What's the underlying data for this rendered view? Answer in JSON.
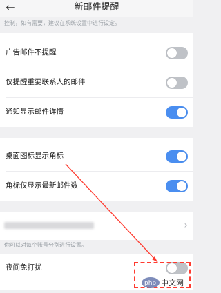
{
  "header": {
    "back_icon": "back-arrow-icon",
    "title": "新邮件提醒"
  },
  "description": "控制，如有需要，建议在系统设置中进行设定。",
  "group1": {
    "rows": [
      {
        "label": "广告邮件不提醒",
        "toggle_on": false
      },
      {
        "label": "仅提醒重要联系人的邮件",
        "toggle_on": false
      },
      {
        "label": "通知显示邮件详情",
        "toggle_on": true
      }
    ]
  },
  "group2": {
    "rows": [
      {
        "label": "桌面图标显示角标",
        "toggle_on": true
      },
      {
        "label": "角标仅显示最新邮件数",
        "toggle_on": true
      }
    ]
  },
  "account": {
    "chevron_icon": "chevron-right-icon"
  },
  "account_hint": "你可以对每个账号分别进行设置。",
  "night_row": {
    "label": "夜间免打扰",
    "toggle_on": false
  },
  "watermark": {
    "text": "php中文网"
  },
  "colors": {
    "toggle_on": "#4a8ef0",
    "toggle_off": "#bfc2c7",
    "annotation": "#ff3b30"
  }
}
